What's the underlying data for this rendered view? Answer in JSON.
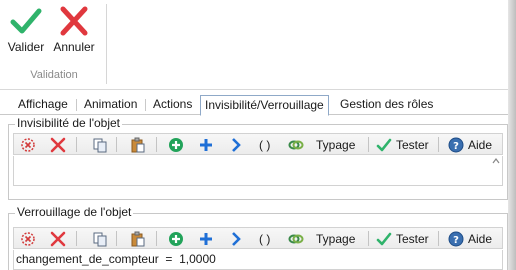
{
  "ribbon": {
    "validate_label": "Valider",
    "cancel_label": "Annuler",
    "group_label": "Validation"
  },
  "tabs": [
    {
      "label": "Affichage",
      "active": false
    },
    {
      "label": "Animation",
      "active": false
    },
    {
      "label": "Actions",
      "active": false
    },
    {
      "label": "Invisibilité/Verrouillage",
      "active": true
    },
    {
      "label": "Gestion des rôles",
      "active": false
    }
  ],
  "invisibility": {
    "title": "Invisibilité de l'objet",
    "typage_label": "Typage",
    "tester_label": "Tester",
    "aide_label": "Aide",
    "parens_label": "( )",
    "content": ""
  },
  "lock": {
    "title": "Verrouillage de l'objet",
    "typage_label": "Typage",
    "tester_label": "Tester",
    "aide_label": "Aide",
    "parens_label": "( )",
    "content": "changement_de_compteur  =  1,0000"
  },
  "colors": {
    "validate_green": "#2fb36b",
    "cancel_red": "#e0383e",
    "accent_blue": "#1f6fd6",
    "active_tab_border": "#8fa9c8"
  }
}
